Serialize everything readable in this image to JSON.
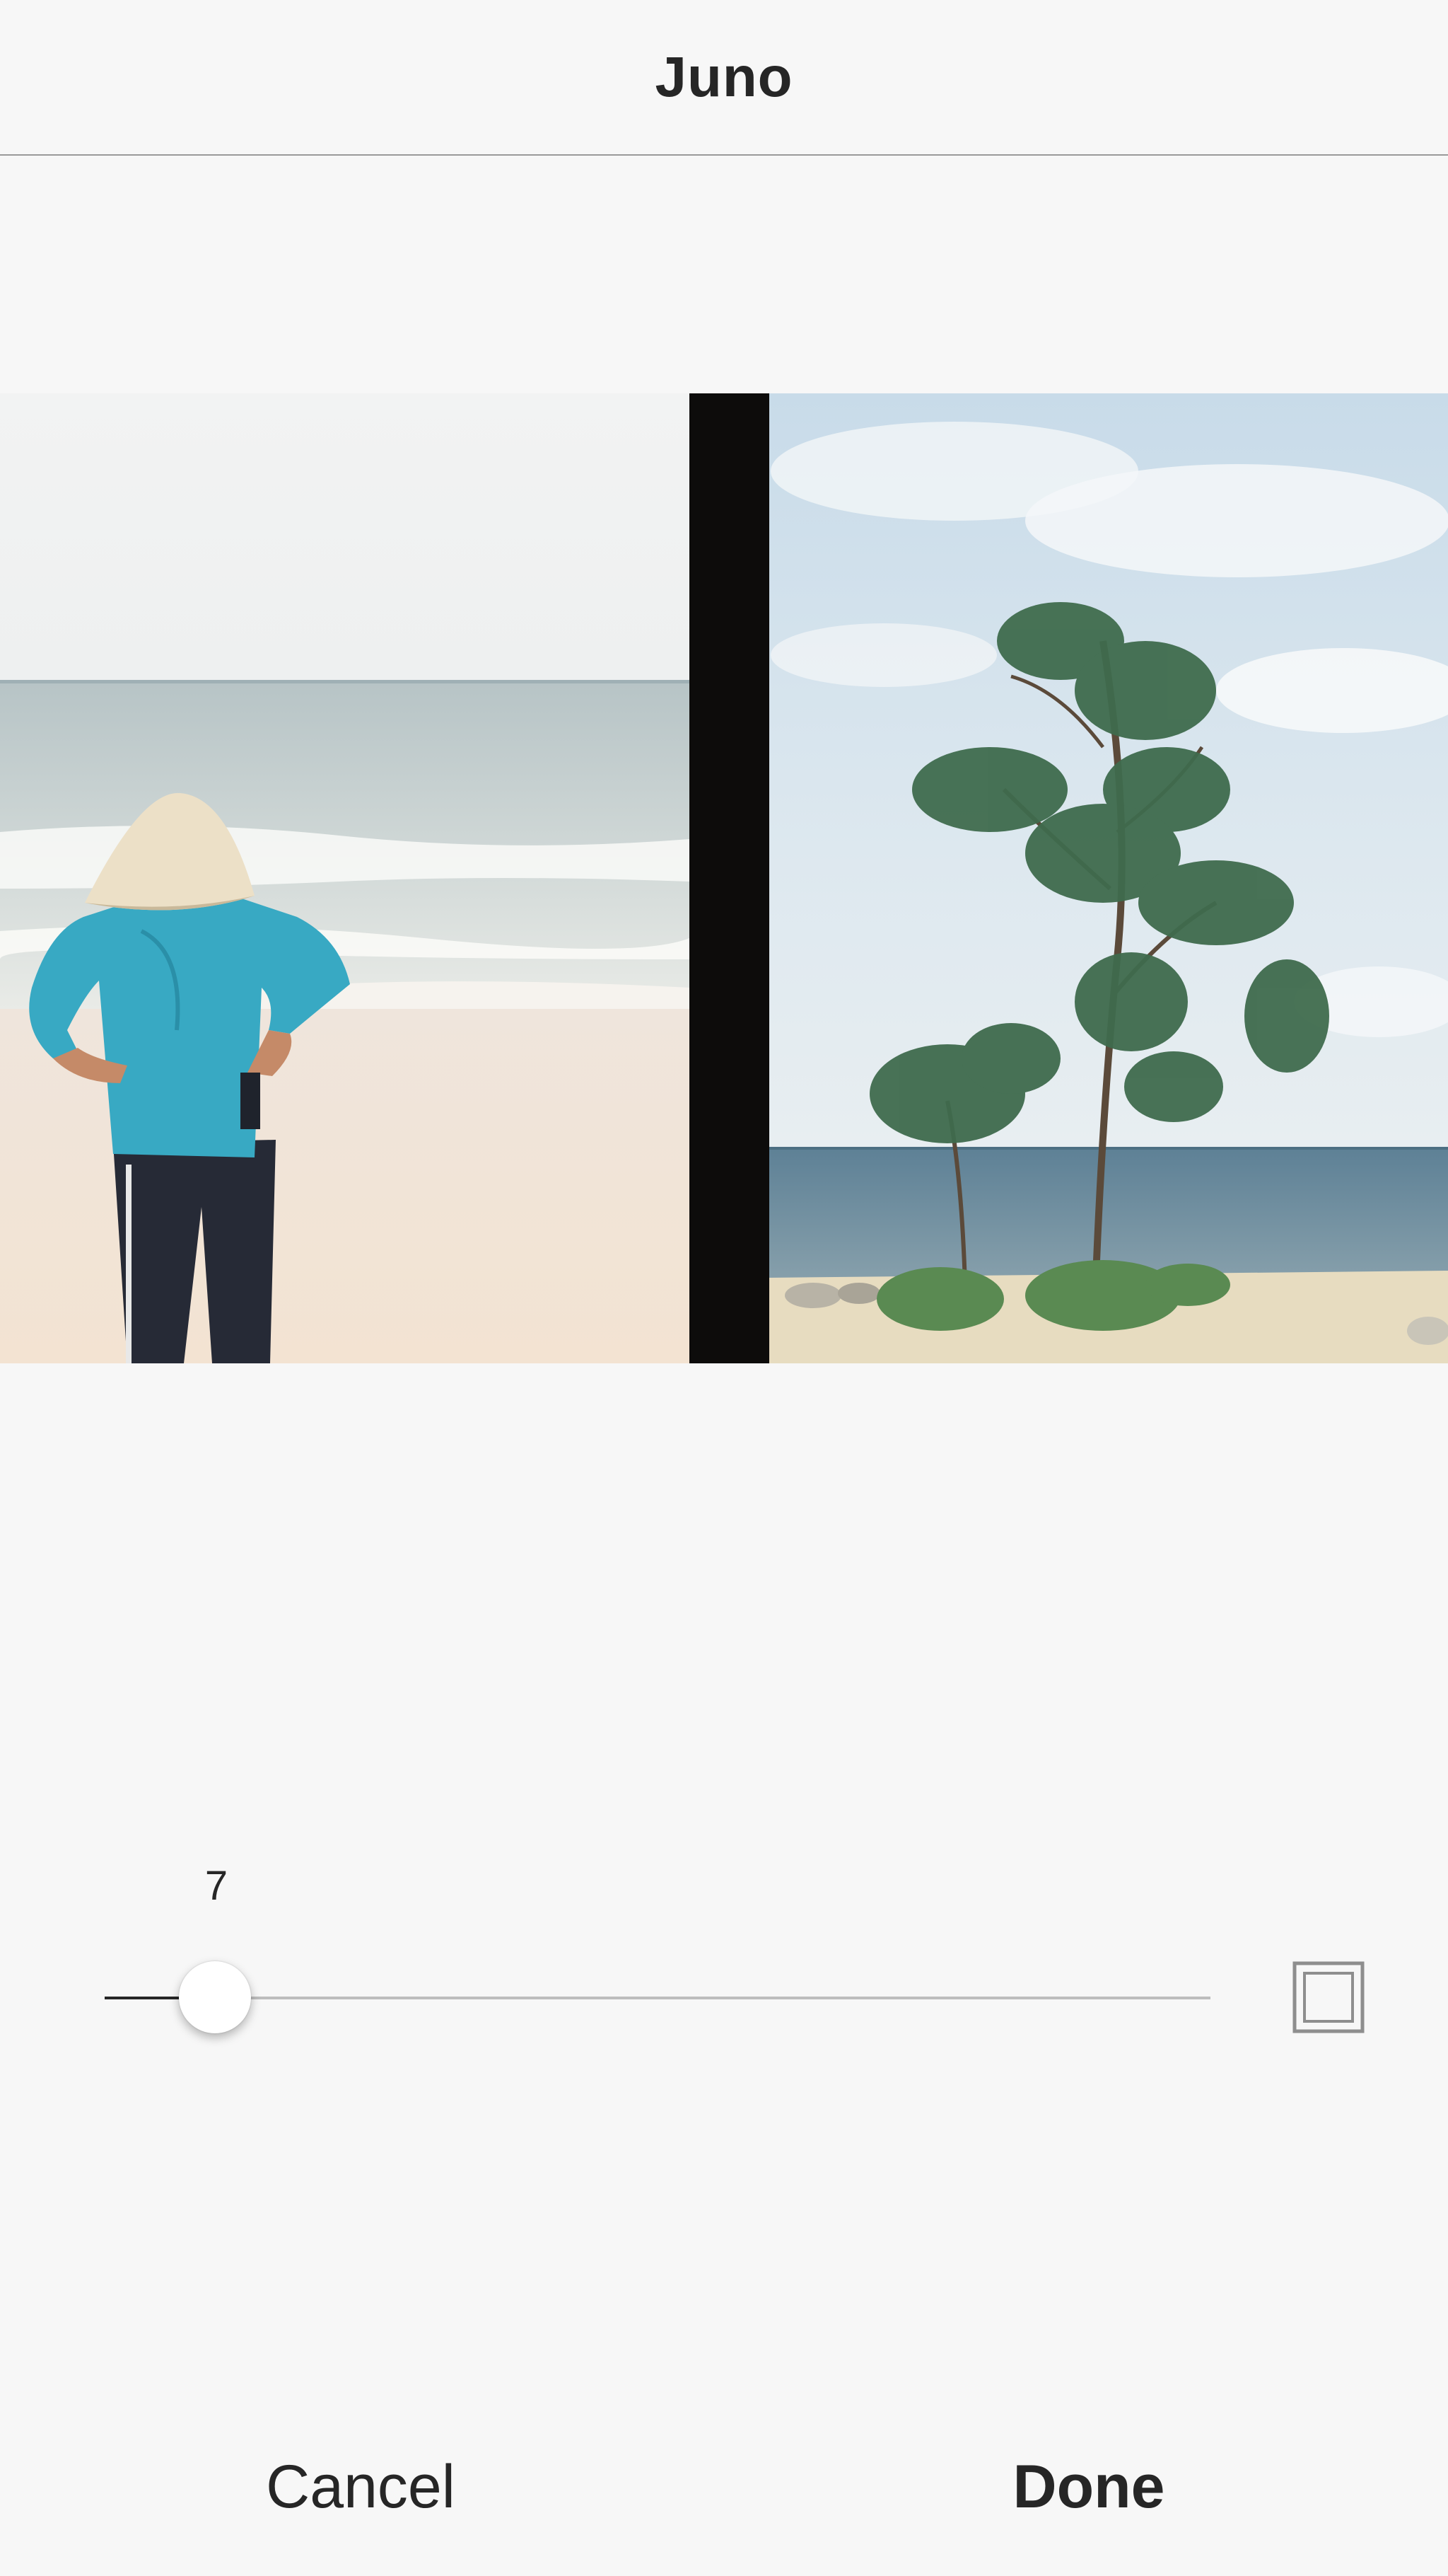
{
  "header": {
    "title": "Juno"
  },
  "photo": {
    "left_scene": "beach-person-conical-hat",
    "right_scene": "beach-tree"
  },
  "adjustment": {
    "value": "7",
    "fraction": 0.1,
    "border_toggle_icon": "frame-border-icon"
  },
  "footer": {
    "cancel_label": "Cancel",
    "done_label": "Done"
  },
  "colors": {
    "background": "#f7f7f7",
    "text": "#262626",
    "track": "#bdbdbd",
    "divider": "#9a9a9a"
  }
}
